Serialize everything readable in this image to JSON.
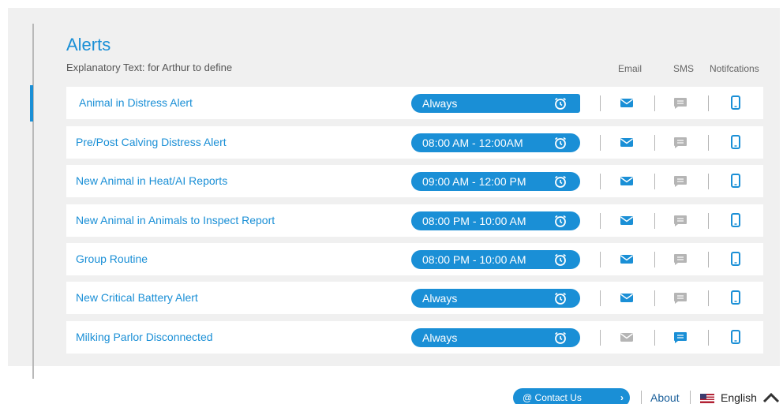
{
  "header": {
    "title": "Alerts",
    "subtitle": "Explanatory Text: for Arthur to define",
    "columns": {
      "email": "Email",
      "sms": "SMS",
      "notifications": "Notifcations"
    }
  },
  "rows": [
    {
      "label": "Animal in Distress Alert",
      "schedule": "Always",
      "email": true,
      "sms": false,
      "notification": true
    },
    {
      "label": "Pre/Post Calving Distress Alert",
      "schedule": "08:00 AM - 12:00AM",
      "email": true,
      "sms": false,
      "notification": true
    },
    {
      "label": "New Animal in Heat/AI Reports",
      "schedule": "09:00 AM - 12:00 PM",
      "email": true,
      "sms": false,
      "notification": true
    },
    {
      "label": "New Animal in Animals to Inspect Report",
      "schedule": "08:00 PM - 10:00 AM",
      "email": true,
      "sms": false,
      "notification": true
    },
    {
      "label": "Group Routine",
      "schedule": "08:00 PM - 10:00 AM",
      "email": true,
      "sms": false,
      "notification": true
    },
    {
      "label": "New Critical Battery Alert",
      "schedule": "Always",
      "email": true,
      "sms": false,
      "notification": true
    },
    {
      "label": "Milking Parlor Disconnected",
      "schedule": "Always",
      "email": false,
      "sms": true,
      "notification": true
    }
  ],
  "icons": {
    "email": "envelope-icon",
    "sms": "message-icon",
    "notification": "mobile-phone-icon",
    "schedule": "alarm-clock-icon"
  },
  "footer": {
    "contact": "Contact Us",
    "about": "About",
    "language": "English"
  },
  "colors": {
    "accent": "#1a8fd6",
    "inactive": "#b5b5b5",
    "panel": "#f0f0f0"
  }
}
